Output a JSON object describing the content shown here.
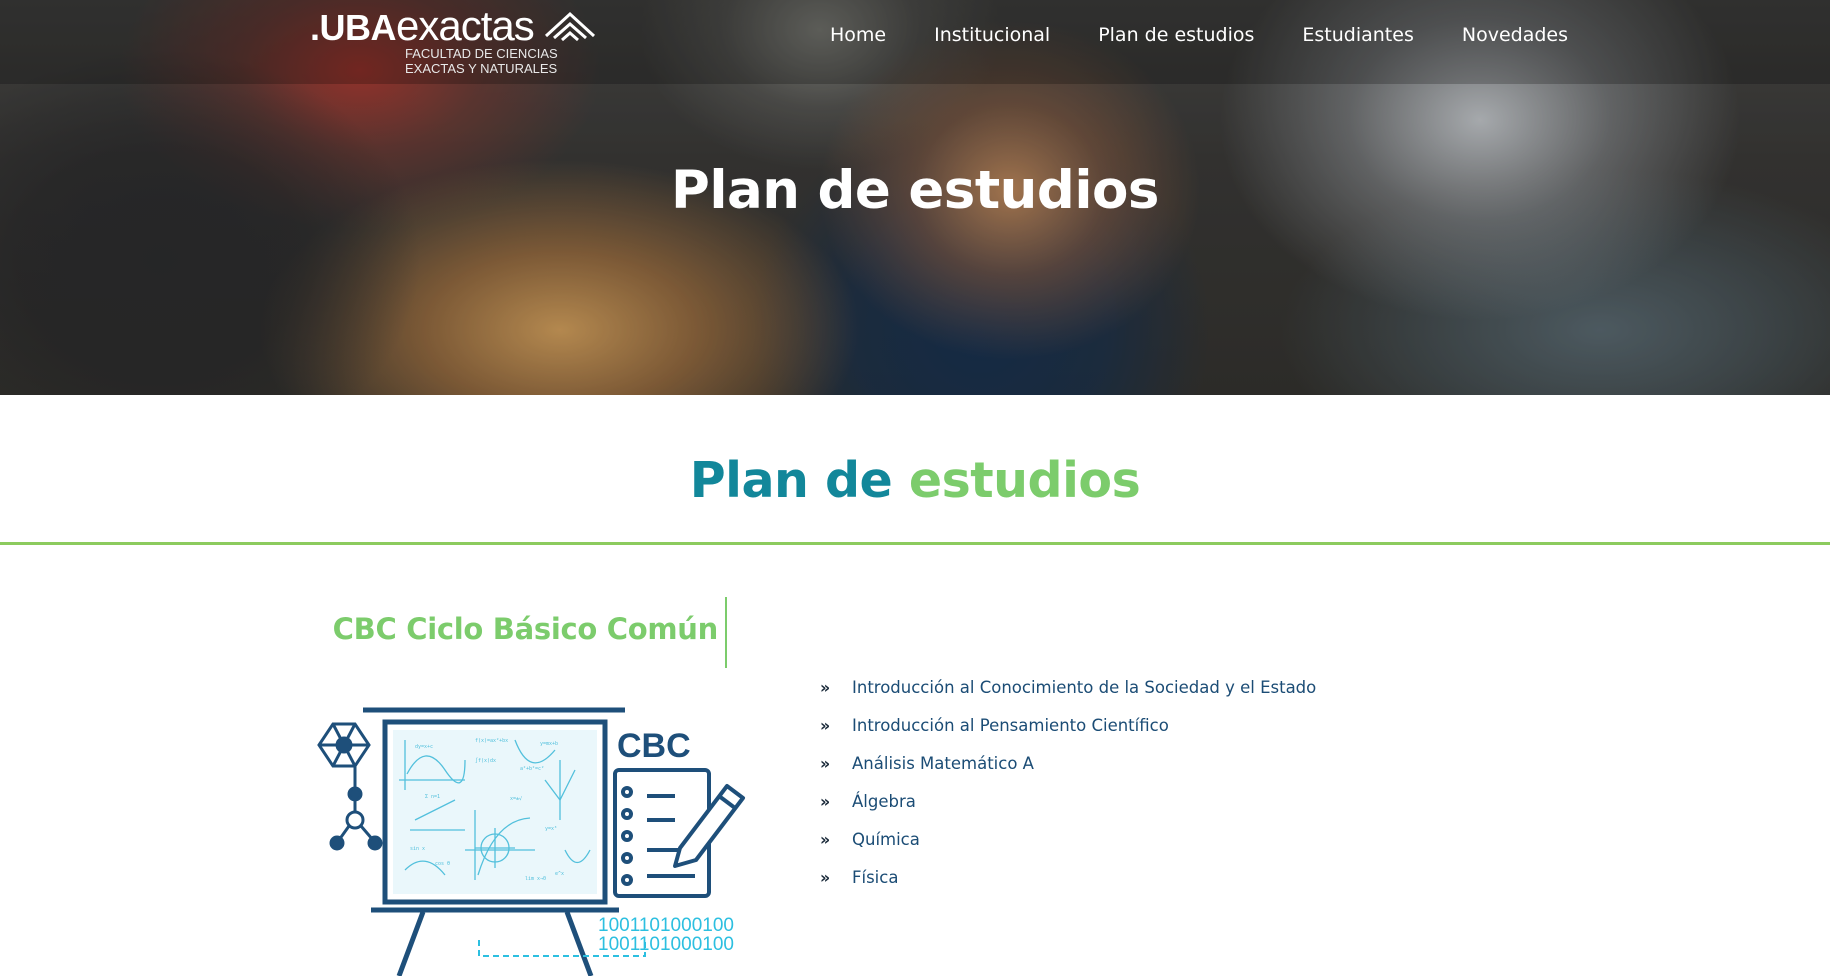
{
  "header": {
    "logo": {
      "uba": ".UBA",
      "exactas": "exactas",
      "subtitle": "FACULTAD DE CIENCIAS EXACTAS Y NATURALES"
    },
    "menu": [
      "Home",
      "Institucional",
      "Plan de estudios",
      "Estudiantes",
      "Novedades"
    ]
  },
  "hero": {
    "title": "Plan de estudios"
  },
  "section": {
    "title_part1": "Plan de",
    "title_part2": "estudios"
  },
  "cbc": {
    "heading": "CBC Ciclo Básico Común",
    "illustration": {
      "label": "CBC",
      "binary_line1": "1001101000100",
      "binary_line2": "1001101000100"
    },
    "subjects": [
      "Introducción al Conocimiento de la Sociedad y el Estado",
      "Introducción al Pensamiento Científico",
      "Análisis Matemático A",
      "Álgebra",
      "Química",
      "Física"
    ]
  },
  "colors": {
    "teal": "#12879a",
    "green": "#7ccc6c",
    "navy": "#1b4c75"
  }
}
